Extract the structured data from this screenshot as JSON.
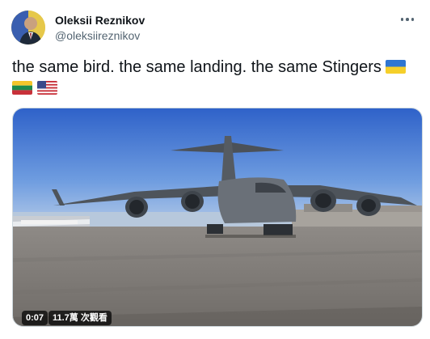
{
  "author": {
    "name": "Oleksii Reznikov",
    "handle": "@oleksiireznikov"
  },
  "tweet": {
    "text": "the same bird. the same landing. the same Stingers",
    "flags": [
      "ukraine-flag-icon",
      "lithuania-flag-icon",
      "usa-flag-icon"
    ]
  },
  "media": {
    "duration": "0:07",
    "views": "11.7萬 次觀看"
  },
  "icons": {
    "more": "more-options-icon",
    "avatar": "avatar"
  },
  "colors": {
    "text": "#0f1419",
    "secondary": "#536471",
    "border": "#cfd9de"
  }
}
